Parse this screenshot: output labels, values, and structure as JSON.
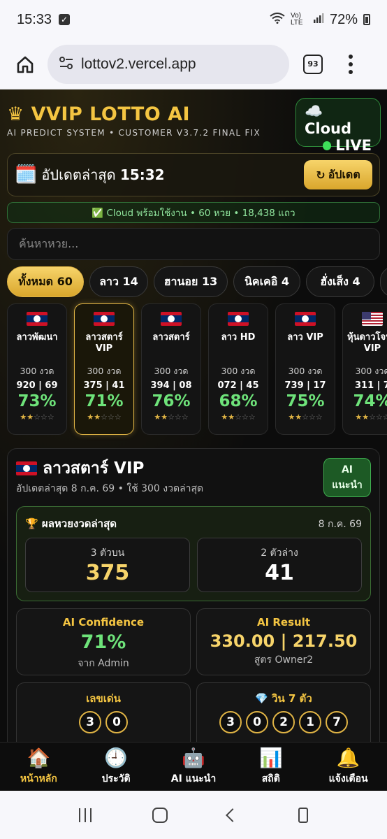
{
  "status_bar": {
    "time": "15:33",
    "battery": "72%",
    "network": "Vo) LTE"
  },
  "browser": {
    "url": "lottov2.vercel.app",
    "tab_count": "93"
  },
  "brand": {
    "title": "VVIP LOTTO AI",
    "subtitle": "AI PREDICT SYSTEM • CUSTOMER V3.7.2 FINAL FIX"
  },
  "cloud_badge": {
    "line1": "Cloud",
    "line2": "LIVE"
  },
  "update": {
    "label": "อัปเดตล่าสุด",
    "time": "15:32",
    "button": "อัปเดต"
  },
  "cloud_status": "✅ Cloud พร้อมใช้งาน • 60 หวย • 18,438 แถว",
  "search": {
    "placeholder": "ค้นหาหวย..."
  },
  "filters": [
    {
      "label": "ทั้งหมด 60",
      "active": true
    },
    {
      "label": "ลาว 14"
    },
    {
      "label": "ฮานอย 13"
    },
    {
      "label": "นิคเคอิ 4"
    },
    {
      "label": "ฮั่งเส็ง 4"
    }
  ],
  "lottery_cards": [
    {
      "flag": "la",
      "name": "ลาวพัฒนา",
      "draws": "300 งวด",
      "nums": "920 | 69",
      "pct": "73%",
      "stars": 2
    },
    {
      "flag": "la",
      "name": "ลาวสตาร์ VIP",
      "draws": "300 งวด",
      "nums": "375 | 41",
      "pct": "71%",
      "stars": 2,
      "selected": true
    },
    {
      "flag": "la",
      "name": "ลาวสตาร์",
      "draws": "300 งวด",
      "nums": "394 | 08",
      "pct": "76%",
      "stars": 2
    },
    {
      "flag": "la",
      "name": "ลาว HD",
      "draws": "300 งวด",
      "nums": "072 | 45",
      "pct": "68%",
      "stars": 2
    },
    {
      "flag": "la",
      "name": "ลาว VIP",
      "draws": "300 งวด",
      "nums": "739 | 17",
      "pct": "75%",
      "stars": 2
    },
    {
      "flag": "us",
      "name": "หุ้นดาวโจนส์ VIP",
      "draws": "300 งวด",
      "nums": "311 | 7",
      "pct": "74%",
      "stars": 2
    }
  ],
  "detail": {
    "title": "ลาวสตาร์ VIP",
    "subtitle": "อัปเดตล่าสุด 8 ก.ค. 69 • ใช้ 300 งวดล่าสุด",
    "ai_button": [
      "AI",
      "แนะนำ"
    ],
    "latest_result": {
      "heading": "ผลหวยงวดล่าสุด",
      "date": "8 ก.ค. 69",
      "top3_label": "3 ตัวบน",
      "top3": "375",
      "bottom2_label": "2 ตัวล่าง",
      "bottom2": "41"
    },
    "confidence": {
      "label": "AI Confidence",
      "value": "71%",
      "source": "จาก Admin"
    },
    "ai_result": {
      "label": "AI Result",
      "value": "330.00 | 217.50",
      "source": "สูตร Owner2"
    },
    "key_numbers": {
      "label": "เลขเด่น",
      "digits": [
        "3",
        "0"
      ]
    },
    "win7": {
      "label": "💎 วิน 7 ตัว",
      "digits": [
        "3",
        "0",
        "2",
        "1",
        "7"
      ]
    }
  },
  "tab_bar": [
    {
      "icon": "🏠",
      "label": "หน้าหลัก",
      "active": true
    },
    {
      "icon": "🕘",
      "label": "ประวัติ"
    },
    {
      "icon": "🤖",
      "label": "AI แนะนำ"
    },
    {
      "icon": "📊",
      "label": "สถิติ"
    },
    {
      "icon": "🔔",
      "label": "แจ้งเตือน"
    }
  ],
  "colors": {
    "accent_gold": "#f4c542",
    "success_green": "#6ee37a",
    "bg": "#0b0b0b"
  }
}
